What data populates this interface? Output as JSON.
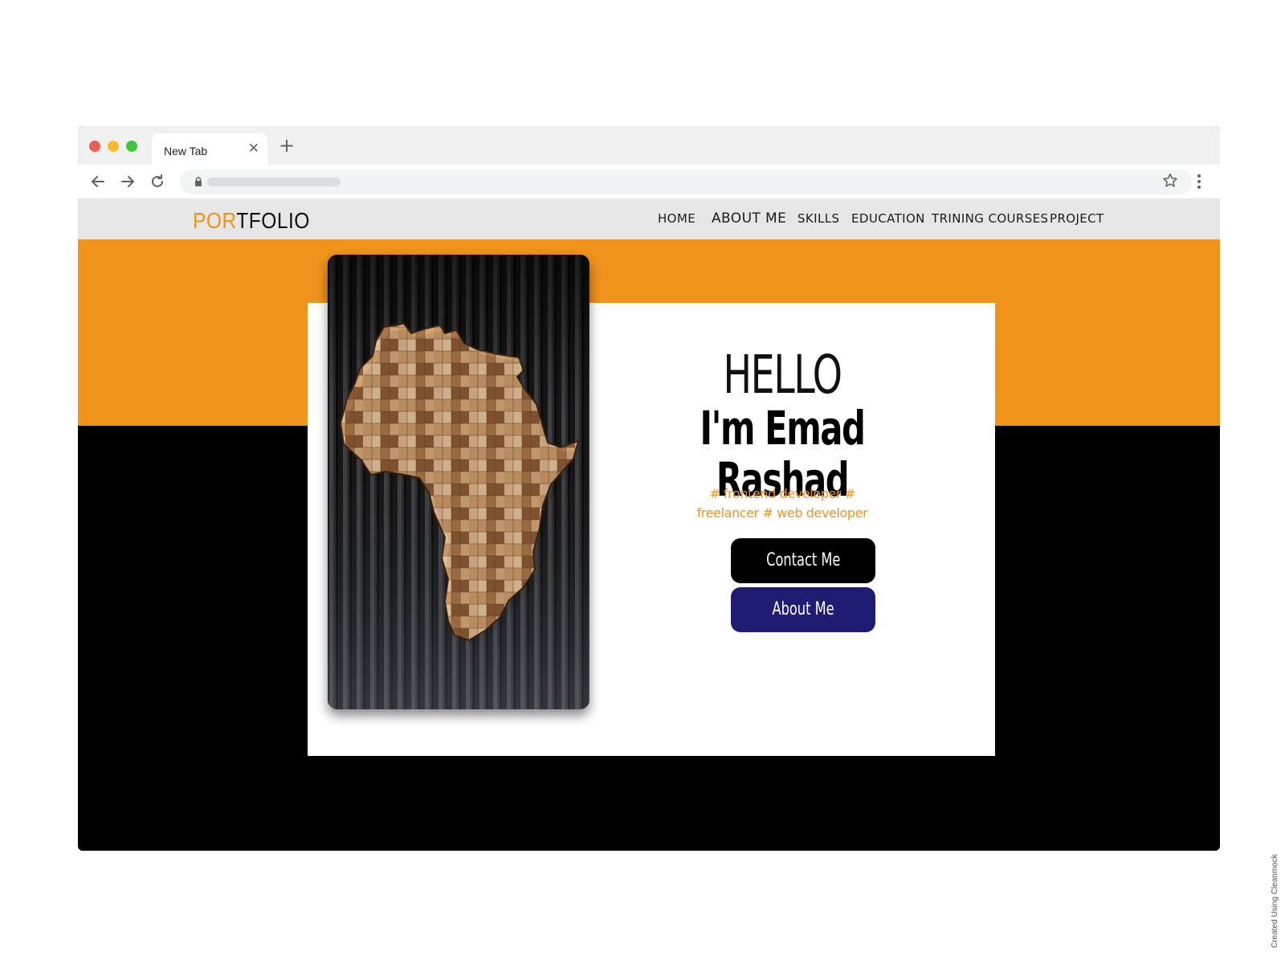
{
  "browser": {
    "tab_title": "New Tab",
    "tab_close_glyph": "✕",
    "new_tab_glyph": "+",
    "icons": [
      "back-arrow-icon",
      "forward-arrow-icon",
      "reload-icon",
      "lock-icon",
      "bookmark-star-icon",
      "menu-kebab-icon"
    ]
  },
  "site": {
    "logo_accent": "POR",
    "logo_rest": "TFOLIO",
    "nav": [
      {
        "label": "HOME"
      },
      {
        "label": "ABOUT ME"
      },
      {
        "label": "SKILLS"
      },
      {
        "label": "EDUCATION"
      },
      {
        "label": "TRINING COURSES"
      },
      {
        "label": "PROJECT"
      }
    ],
    "hero": {
      "greeting": "HELLO",
      "name": "I'm Emad Rashad",
      "tagline_line1": "# frontend developer #",
      "tagline_line2": "freelancer # web developer",
      "contact_button": "Contact Me",
      "about_button": "About Me",
      "image_description": "africa-wood-mosaic"
    },
    "colors": {
      "accent": "#ef931d",
      "header_bg": "#e6e6e6",
      "hero_dark": "#000000",
      "about_button_bg": "#1f1d73"
    }
  },
  "credit": "Created Using Cleanmock"
}
